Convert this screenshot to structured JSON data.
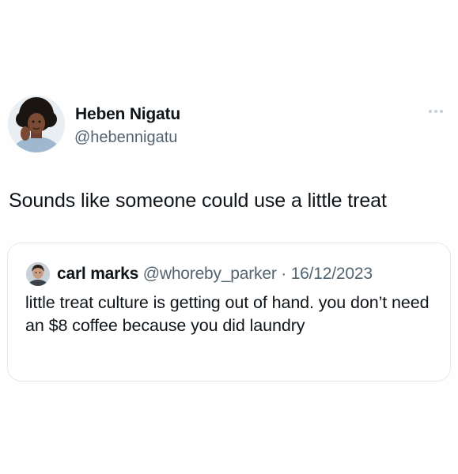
{
  "tweet": {
    "author_name": "Heben Nigatu",
    "author_handle": "@hebennigatu",
    "avatar_icon": "user-avatar",
    "more_icon": "more-horizontal-icon",
    "text": "Sounds like someone could use a little treat"
  },
  "quoted_tweet": {
    "author_name": "carl marks",
    "author_handle": "@whoreby_parker",
    "separator": " · ",
    "date": "16/12/2023",
    "avatar_icon": "user-avatar",
    "text": "little treat culture is getting out of hand. you don’t need an $8 coffee because you did laundry"
  },
  "colors": {
    "text_primary": "#0f1419",
    "text_secondary": "#536471",
    "card_border": "#e1e8ed"
  }
}
